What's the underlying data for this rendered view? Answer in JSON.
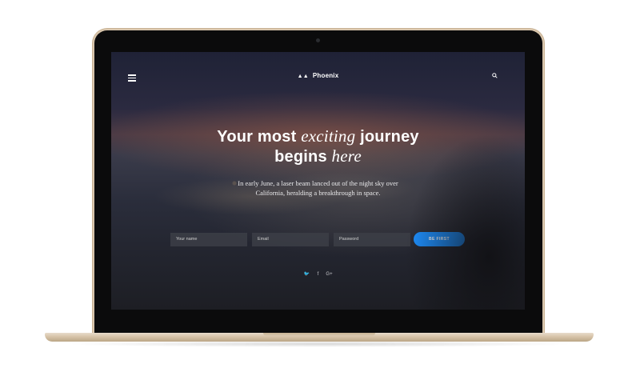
{
  "nav": {
    "brand": "Phoenix",
    "menu_icon": "hamburger-menu-icon",
    "search_icon": "search-icon",
    "logo_icon": "phoenix-logo-icon"
  },
  "hero": {
    "title_line1_a": "Your most",
    "title_line1_em": "exciting",
    "title_line1_b": "journey",
    "title_line2_a": "begins",
    "title_line2_em": "here",
    "subtitle_line1": "In early June, a laser beam lanced out of the night sky over",
    "subtitle_line2": "California, heralding a breakthrough in space."
  },
  "form": {
    "name_placeholder": "Your name",
    "email_placeholder": "Email",
    "password_placeholder": "Password",
    "submit_label": "BE FIRST",
    "accent_color": "#1e90ff"
  },
  "social": [
    {
      "icon": "twitter-icon",
      "glyph": "🐦"
    },
    {
      "icon": "facebook-icon",
      "glyph": "f"
    },
    {
      "icon": "google-plus-icon",
      "glyph": "G+"
    }
  ]
}
